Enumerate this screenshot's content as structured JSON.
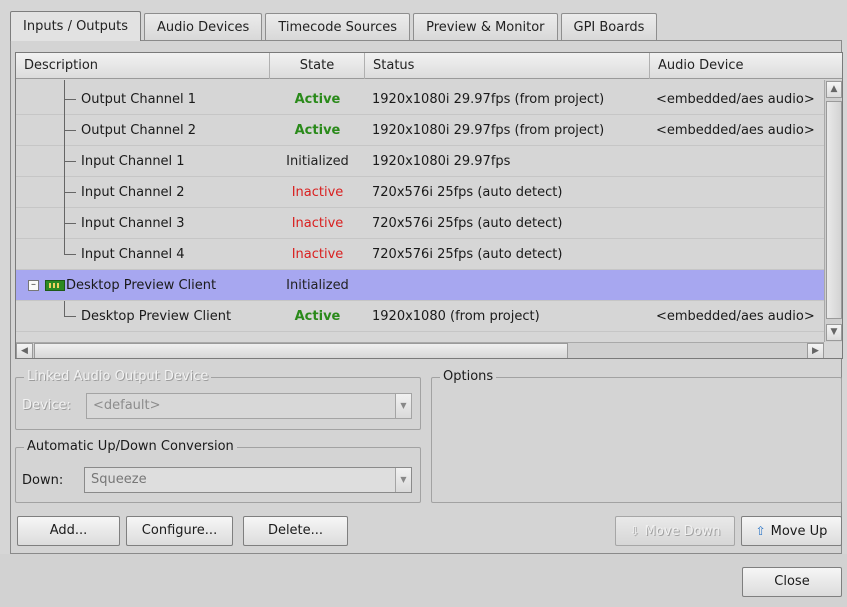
{
  "tabs": [
    {
      "label": "Inputs / Outputs",
      "active": true
    },
    {
      "label": "Audio Devices",
      "active": false
    },
    {
      "label": "Timecode Sources",
      "active": false
    },
    {
      "label": "Preview & Monitor",
      "active": false
    },
    {
      "label": "GPI Boards",
      "active": false
    }
  ],
  "table": {
    "columns": [
      "Description",
      "State",
      "Status",
      "Audio Device"
    ],
    "rows": [
      {
        "description": "Output Channel 1",
        "state": "Active",
        "status": "1920x1080i 29.97fps (from project)",
        "audio": "<embedded/aes audio>"
      },
      {
        "description": "Output Channel 2",
        "state": "Active",
        "status": "1920x1080i 29.97fps (from project)",
        "audio": "<embedded/aes audio>"
      },
      {
        "description": "Input Channel 1",
        "state": "Initialized",
        "status": "1920x1080i 29.97fps",
        "audio": ""
      },
      {
        "description": "Input Channel 2",
        "state": "Inactive",
        "status": "720x576i 25fps (auto detect)",
        "audio": ""
      },
      {
        "description": "Input Channel 3",
        "state": "Inactive",
        "status": "720x576i 25fps (auto detect)",
        "audio": ""
      },
      {
        "description": "Input Channel 4",
        "state": "Inactive",
        "status": "720x576i 25fps (auto detect)",
        "audio": ""
      },
      {
        "description": "Desktop Preview Client",
        "state": "Initialized",
        "status": "",
        "audio": ""
      },
      {
        "description": "Desktop Preview Client",
        "state": "Active",
        "status": "1920x1080 (from project)",
        "audio": "<embedded/aes audio>"
      }
    ],
    "selected_row": 6
  },
  "linked_audio": {
    "title": "Linked Audio Output Device",
    "device_label": "Device:",
    "device_value": "<default>"
  },
  "conversion": {
    "title": "Automatic Up/Down Conversion",
    "down_label": "Down:",
    "down_value": "Squeeze"
  },
  "options": {
    "title": "Options"
  },
  "buttons": {
    "add": "Add...",
    "configure": "Configure...",
    "delete": "Delete...",
    "move_down": "Move Down",
    "move_up": "Move Up",
    "close": "Close"
  },
  "colors": {
    "active": "#2a8a1a",
    "inactive": "#d92020",
    "selection": "#a7a7f0"
  }
}
